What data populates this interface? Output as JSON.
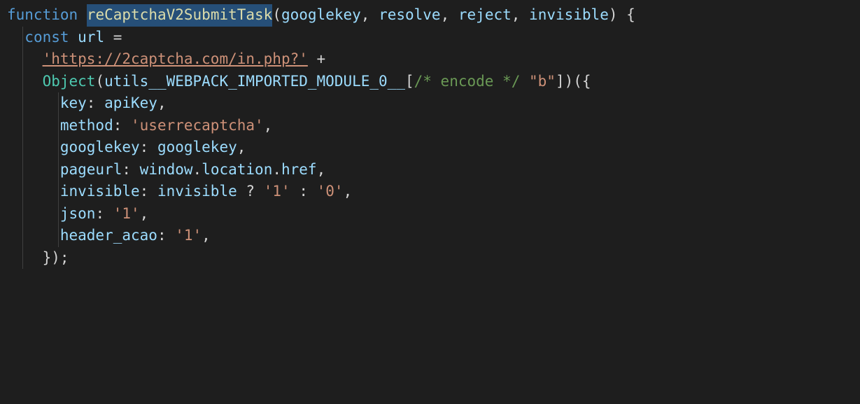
{
  "code": {
    "l1": {
      "kw_function": "function",
      "sp1": " ",
      "fn_name": "reCaptchaV2SubmitTask",
      "open_paren": "(",
      "p1": "googlekey",
      "c1": ", ",
      "p2": "resolve",
      "c2": ", ",
      "p3": "reject",
      "c3": ", ",
      "p4": "invisible",
      "close_paren": ")",
      "sp2": " ",
      "brace": "{"
    },
    "l2": {
      "indent": "  ",
      "kw_const": "const",
      "sp1": " ",
      "var": "url",
      "sp2": " ",
      "eq": "=",
      "sp3": " "
    },
    "l3": {
      "indent": "    ",
      "str": "'https://2captcha.com/in.php?'",
      "sp1": " ",
      "plus": "+"
    },
    "l4": {
      "indent": "    ",
      "obj": "Object",
      "open_paren": "(",
      "var": "utils__WEBPACK_IMPORTED_MODULE_0__",
      "br_open": "[",
      "comment": "/* encode */",
      "sp1": " ",
      "str": "\"b\"",
      "br_close": "]",
      "close_paren": ")",
      "open_paren2": "(",
      "brace": "{"
    },
    "l5": {
      "indent": "      ",
      "prop": "key",
      "colon": ": ",
      "val": "apiKey",
      "comma": ","
    },
    "l6": {
      "indent": "      ",
      "prop": "method",
      "colon": ": ",
      "str": "'userrecaptcha'",
      "comma": ","
    },
    "l7": {
      "indent": "      ",
      "prop": "googlekey",
      "colon": ": ",
      "val": "googlekey",
      "comma": ","
    },
    "l8": {
      "indent": "      ",
      "prop": "pageurl",
      "colon": ": ",
      "v1": "window",
      "d1": ".",
      "v2": "location",
      "d2": ".",
      "v3": "href",
      "comma": ","
    },
    "l9": {
      "indent": "      ",
      "prop": "invisible",
      "colon": ": ",
      "val": "invisible",
      "sp1": " ",
      "q": "?",
      "sp2": " ",
      "s1": "'1'",
      "sp3": " ",
      "colon2": ":",
      "sp4": " ",
      "s0": "'0'",
      "comma": ","
    },
    "l10": {
      "indent": "      ",
      "prop": "json",
      "colon": ": ",
      "str": "'1'",
      "comma": ","
    },
    "l11": {
      "indent": "      ",
      "prop": "header_acao",
      "colon": ": ",
      "str": "'1'",
      "comma": ","
    },
    "l12": {
      "indent": "    ",
      "brace": "}",
      "paren": ")",
      "semi": ";"
    }
  }
}
